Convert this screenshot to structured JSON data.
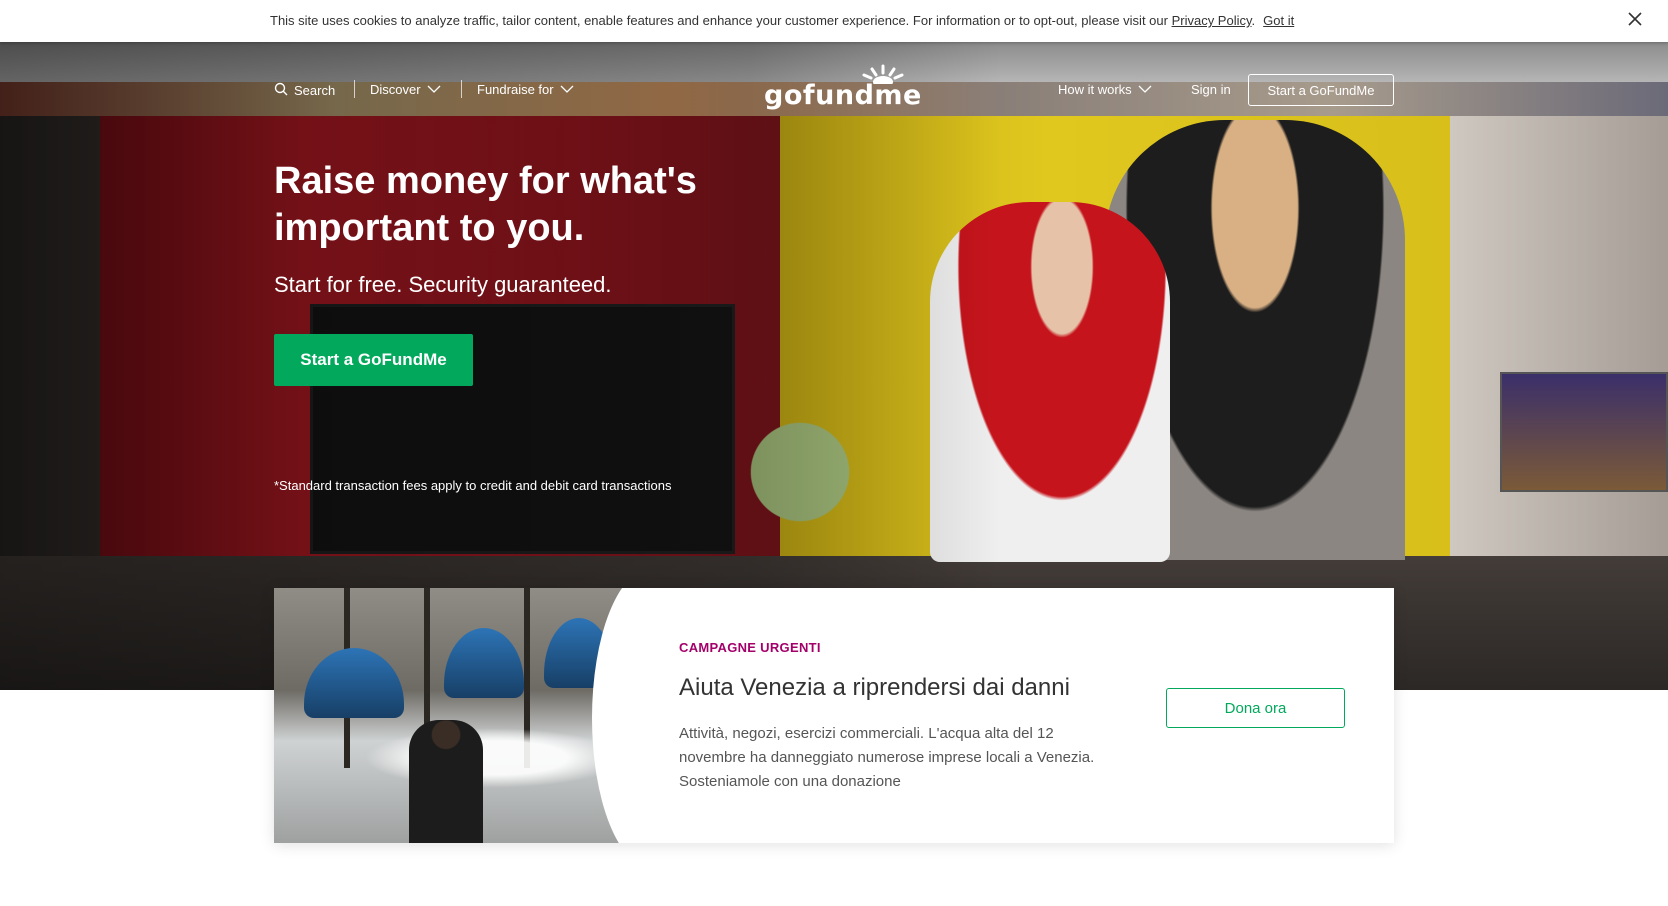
{
  "cookie": {
    "text": "This site uses cookies to analyze traffic, tailor content, enable features and enhance your customer experience. For information or to opt-out, please visit our ",
    "privacy_link": "Privacy Policy",
    "separator": ".",
    "got_it": "Got it"
  },
  "nav": {
    "search": "Search",
    "discover": "Discover",
    "fundraise_for": "Fundraise for",
    "logo": "gofundme",
    "how_it_works": "How it works",
    "sign_in": "Sign in",
    "start_button": "Start a GoFundMe"
  },
  "hero": {
    "title": "Raise money for what's important to you.",
    "subtitle": "Start for free. Security guaranteed.",
    "cta": "Start a GoFundMe",
    "note": "*Standard transaction fees apply to credit and debit card transactions"
  },
  "campaign": {
    "tag": "CAMPAGNE URGENTI",
    "title": "Aiuta Venezia a riprendersi dai danni",
    "description": "Attività, negozi, esercizi commerciali. L'acqua alta del 12 novembre ha danneggiato numerose imprese locali a Venezia. Sosteniamole con una donazione",
    "button": "Dona ora"
  },
  "colors": {
    "brand_green": "#02a95c",
    "tag_magenta": "#a4006a"
  }
}
